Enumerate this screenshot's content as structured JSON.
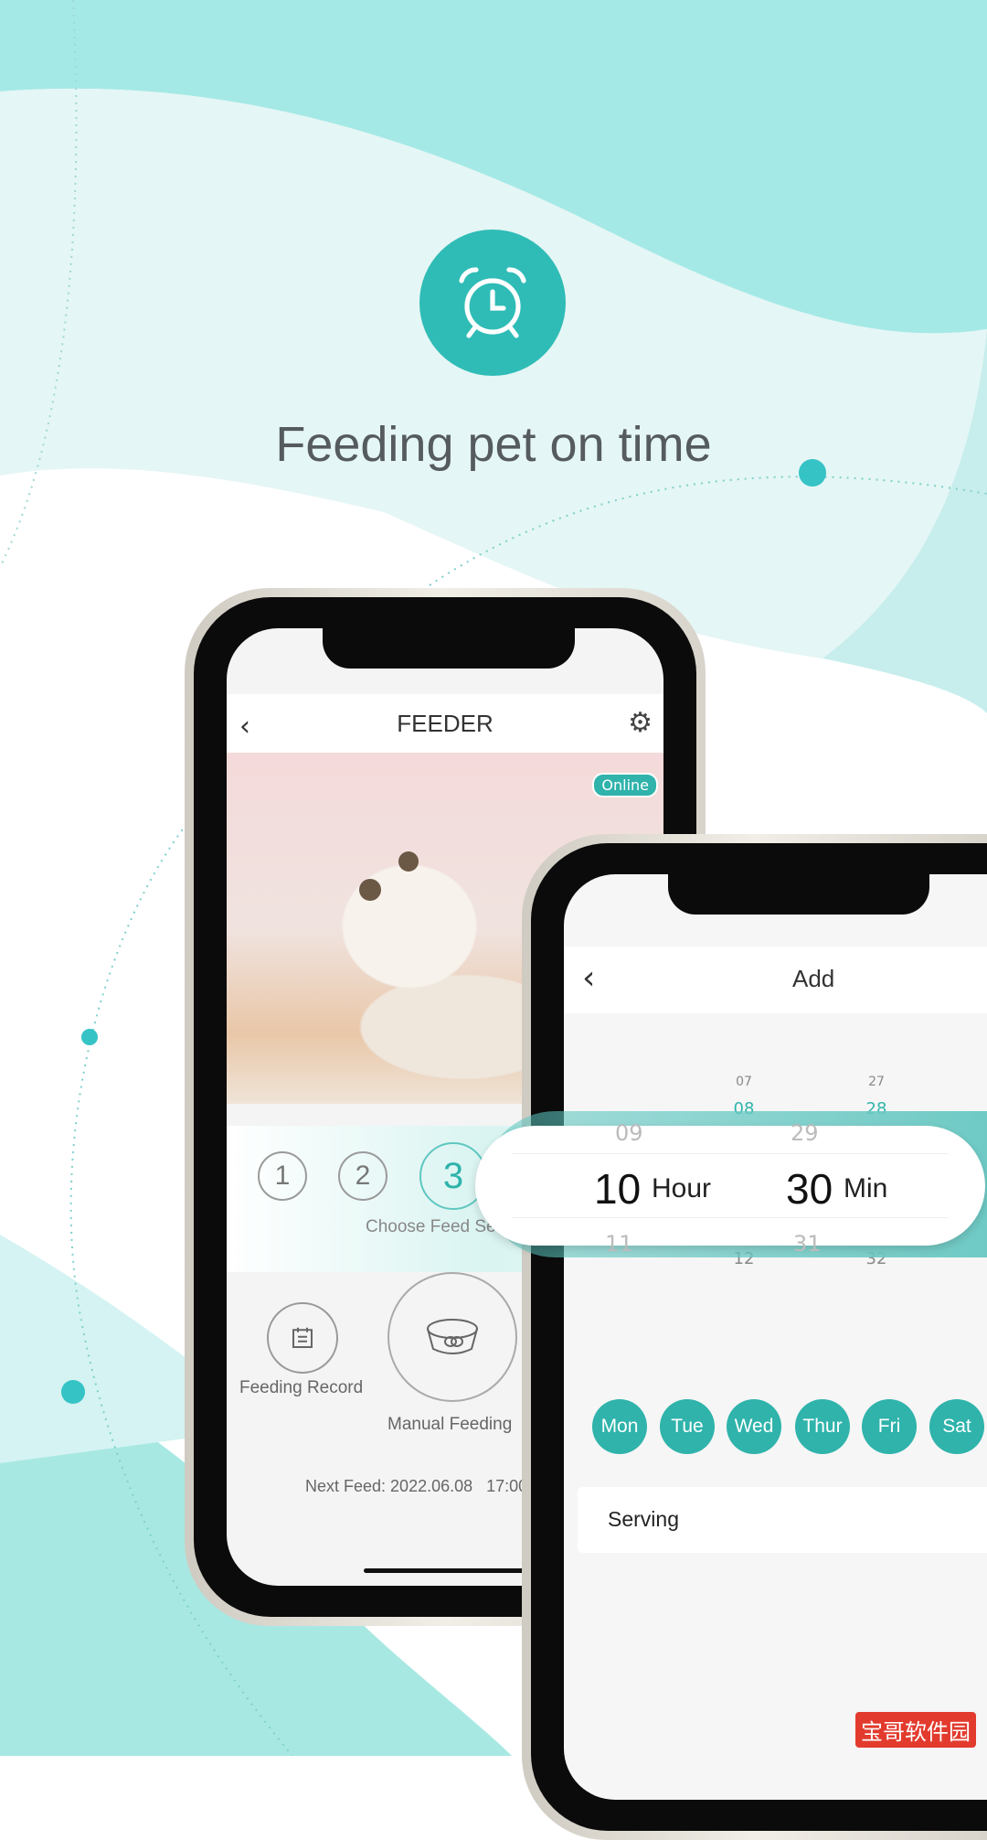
{
  "hero": {
    "icon": "alarm-clock-icon",
    "title": "Feeding pet on time"
  },
  "colors": {
    "accent": "#2fbcb6",
    "background_teal": "#a3e8e6",
    "day_chip": "#2fb3ab"
  },
  "feeder_screen": {
    "back_icon": "chevron-left-icon",
    "title": "FEEDER",
    "settings_icon": "gear-icon",
    "status_badge": "Online",
    "steps": [
      "1",
      "2",
      "3"
    ],
    "steps_caption": "Choose Feed Ser",
    "feeding_record_label": "Feeding Record",
    "manual_feeding_label": "Manual Feeding",
    "next_feed": "Next Feed: 2022.06.08   17:00"
  },
  "add_screen": {
    "back_icon": "chevron-left-icon",
    "title": "Add",
    "hour_column": {
      "above": [
        "07",
        "08",
        "09"
      ],
      "selected": "10",
      "below": [
        "11",
        "12"
      ],
      "unit": "Hour"
    },
    "minute_column": {
      "above": [
        "27",
        "28",
        "29"
      ],
      "selected": "30",
      "below": [
        "31",
        "32"
      ],
      "unit": "Min"
    },
    "days": [
      "Mon",
      "Tue",
      "Wed",
      "Thur",
      "Fri",
      "Sat"
    ],
    "serving_label": "Serving"
  },
  "watermark": "宝哥软件园"
}
